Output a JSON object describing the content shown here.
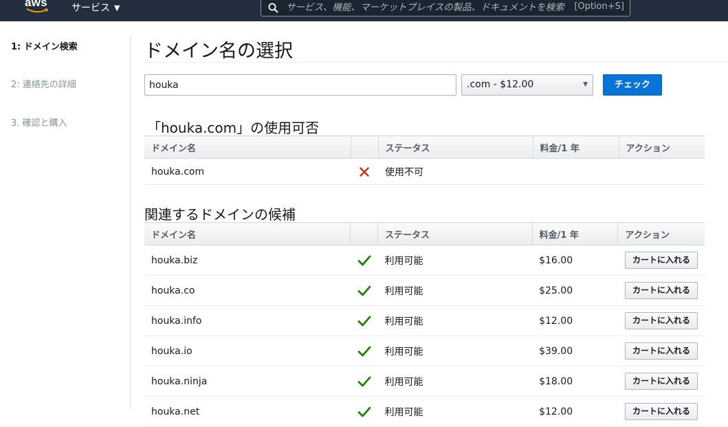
{
  "nav": {
    "logo_text": "aws",
    "services_label": "サービス",
    "search_placeholder": "サービス、機能、マーケットプレイスの製品、ドキュメントを検索",
    "search_shortcut": "[Option+S]"
  },
  "sidebar": {
    "steps": [
      {
        "label": "1: ドメイン検索"
      },
      {
        "label": "2: 連絡先の詳細"
      },
      {
        "label": "3. 確認と購入"
      }
    ]
  },
  "main": {
    "title": "ドメイン名の選択",
    "domain_input_value": "houka",
    "tld_selected": ".com - $12.00",
    "check_label": "チェック"
  },
  "availability": {
    "title": "「houka.com」の使用可否",
    "headers": {
      "name": "ドメイン名",
      "status": "ステータス",
      "price": "料金/1 年",
      "action": "アクション"
    },
    "rows": [
      {
        "name": "houka.com",
        "status": "使用不可",
        "price": "",
        "available": false
      }
    ]
  },
  "suggestions": {
    "title": "関連するドメインの候補",
    "headers": {
      "name": "ドメイン名",
      "status": "ステータス",
      "price": "料金/1 年",
      "action": "アクション"
    },
    "cart_label": "カートに入れる",
    "rows": [
      {
        "name": "houka.biz",
        "status": "利用可能",
        "price": "$16.00"
      },
      {
        "name": "houka.co",
        "status": "利用可能",
        "price": "$25.00"
      },
      {
        "name": "houka.info",
        "status": "利用可能",
        "price": "$12.00"
      },
      {
        "name": "houka.io",
        "status": "利用可能",
        "price": "$39.00"
      },
      {
        "name": "houka.ninja",
        "status": "利用可能",
        "price": "$18.00"
      },
      {
        "name": "houka.net",
        "status": "利用可能",
        "price": "$12.00"
      }
    ]
  },
  "colors": {
    "nav_bg": "#232f3e",
    "primary_button": "#0a73d8",
    "available_check": "#1d8102",
    "unavailable_x": "#d13212"
  }
}
